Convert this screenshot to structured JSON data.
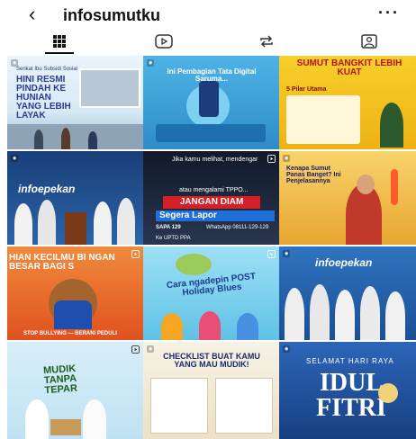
{
  "header": {
    "back_icon": "chevron-left-icon",
    "title": "infosumutku",
    "more_label": "···"
  },
  "tabs": [
    {
      "name": "grid",
      "icon": "grid-icon"
    },
    {
      "name": "reels",
      "icon": "play-icon"
    },
    {
      "name": "reposts",
      "icon": "repost-icon"
    },
    {
      "name": "tagged",
      "icon": "tagged-person-icon"
    }
  ],
  "posts": [
    {
      "title": "HINI RESMI PINDAH KE HUNIAN YANG LEBIH LAYAK",
      "sub": "Serikat Ibu Subsidi Sosial"
    },
    {
      "title": "Ini Pembagian Tata Digital Saruma...",
      "sub": ""
    },
    {
      "title": "SUMUT BANGKIT LEBIH KUAT",
      "sub": "5 Pilar Utama"
    },
    {
      "title": "infoepekan",
      "sub": ""
    },
    {
      "title": "JANGAN DIAM",
      "sub": "Segera Lapor",
      "top": "Jika kamu melihat, mendengar",
      "mid": "atau mengalami TPPO...",
      "foot": "SAPA 129",
      "foot2": "WhatsApp 08111-129-129",
      "foot3": "Ke UPTD PPA"
    },
    {
      "title": "Kenapa Sumut Panas Banget? Ini Penjelasannya",
      "sub": ""
    },
    {
      "title": "HIAN KECILMU BI NGAN BESAR BAGI S",
      "sub": "STOP BULLYING — BERANI PEDULI"
    },
    {
      "title": "Cara ngadepin POST Holiday Blues",
      "sub": ""
    },
    {
      "title": "infoepekan",
      "sub": ""
    },
    {
      "title": "MUDIK TANPA TEPAR",
      "sub": ""
    },
    {
      "title": "CHECKLIST BUAT KAMU YANG MAU MUDIK!",
      "sub": ""
    },
    {
      "title": "IDUL FITRI",
      "sub": "SELAMAT HARI RAYA"
    }
  ],
  "colors": {
    "accent": "#111111",
    "tile1": "#e9f3fb",
    "tile2": "#3fa4d8",
    "tile3": "#f4c21a",
    "tile4": "#1f4f87",
    "tile5": "#1c2a3d",
    "tile6": "#f6c44a",
    "tile7": "#e9662b",
    "tile8": "#6fc2e8",
    "tile9": "#2b6fb8",
    "tile10": "#cfe9f6",
    "tile11": "#f4efe3",
    "tile12": "#1d4f9a"
  }
}
